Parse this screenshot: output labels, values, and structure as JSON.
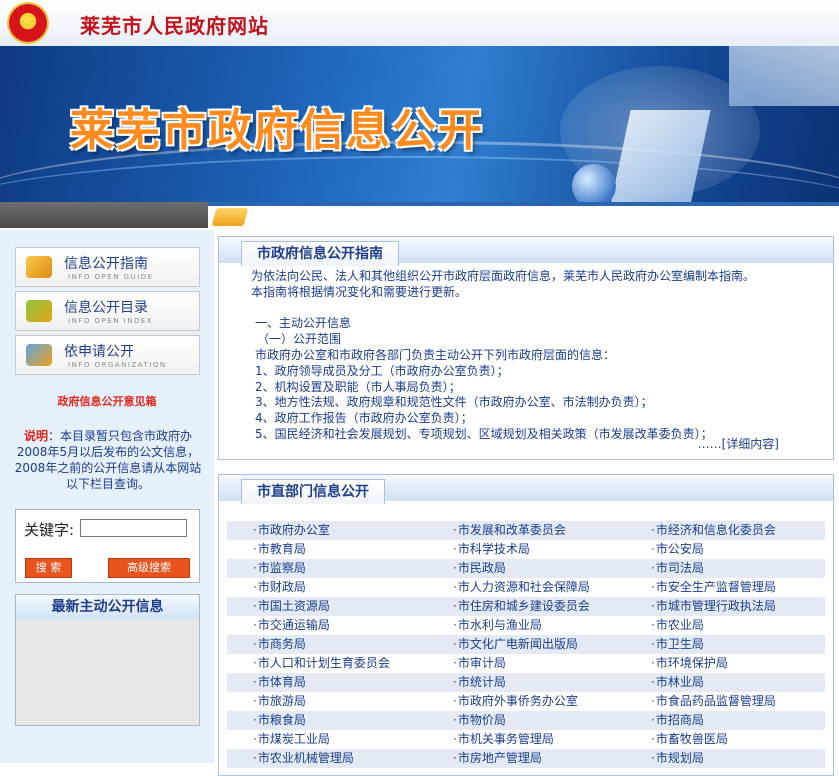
{
  "header": {
    "site_title": "莱芜市人民政府网站"
  },
  "banner": {
    "title": "莱芜市政府信息公开"
  },
  "sidebar": {
    "nav": [
      {
        "label": "信息公开指南",
        "sub": "INFO OPEN GUIDE"
      },
      {
        "label": "信息公开目录",
        "sub": "INFO OPEN INDEX"
      },
      {
        "label": "依申请公开",
        "sub": "INFO ORGANIZATION"
      }
    ],
    "feedback_link": "政府信息公开意见箱",
    "note_label": "说明",
    "note_text": "：本目录暂只包含市政府办2008年5月以后发布的公文信息，2008年之前的公开信息请从本网站以下栏目查询。",
    "search": {
      "keyword_label": "关键字:",
      "keyword_value": "",
      "search_button": "搜 索",
      "advanced_button": "高级搜索"
    },
    "latest_title": "最新主动公开信息"
  },
  "guide": {
    "title": "市政府信息公开指南",
    "lines": [
      "为依法向公民、法人和其他组织公开市政府层面政府信息，莱芜市人民政府办公室编制本指南。",
      "本指南将根据情况变化和需要进行更新。",
      "",
      "一、主动公开信息",
      "（一）公开范围",
      "市政府办公室和市政府各部门负责主动公开下列市政府层面的信息：",
      "1、政府领导成员及分工（市政府办公室负责）；",
      "2、机构设置及职能（市人事局负责）；",
      "3、地方性法规、政府规章和规范性文件（市政府办公室、市法制办负责）；",
      "4、政府工作报告（市政府办公室负责）；",
      "5、国民经济和社会发展规划、专项规划、区域规划及相关政策（市发展改革委负责）；"
    ],
    "more": "……[详细内容]"
  },
  "departments": {
    "title": "市直部门信息公开",
    "rows": [
      [
        "市政府办公室",
        "市发展和改革委员会",
        "市经济和信息化委员会"
      ],
      [
        "市教育局",
        "市科学技术局",
        "市公安局"
      ],
      [
        "市监察局",
        "市民政局",
        "市司法局"
      ],
      [
        "市财政局",
        "市人力资源和社会保障局",
        "市安全生产监督管理局"
      ],
      [
        "市国土资源局",
        "市住房和城乡建设委员会",
        "市城市管理行政执法局"
      ],
      [
        "市交通运输局",
        "市水利与渔业局",
        "市农业局"
      ],
      [
        "市商务局",
        "市文化广电新闻出版局",
        "市卫生局"
      ],
      [
        "市人口和计划生育委员会",
        "市审计局",
        "市环境保护局"
      ],
      [
        "市体育局",
        "市统计局",
        "市林业局"
      ],
      [
        "市旅游局",
        "市政府外事侨务办公室",
        "市食品药品监督管理局"
      ],
      [
        "市粮食局",
        "市物价局",
        "市招商局"
      ],
      [
        "市煤炭工业局",
        "市机关事务管理局",
        "市畜牧兽医局"
      ],
      [
        "市农业机械管理局",
        "市房地产管理局",
        "市规划局"
      ]
    ]
  }
}
